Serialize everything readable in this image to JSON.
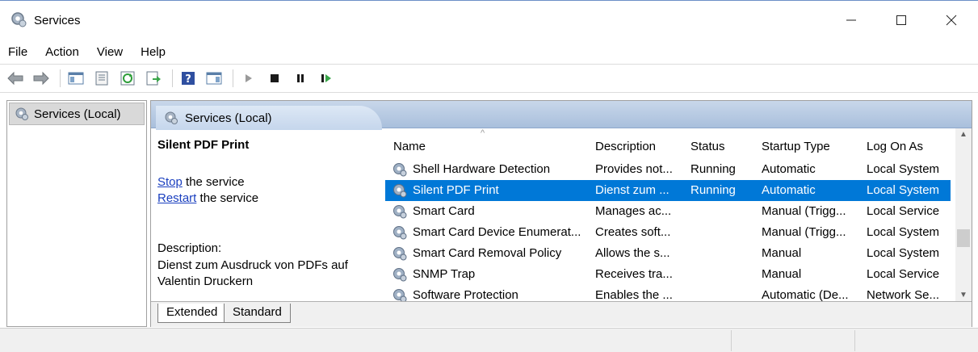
{
  "window": {
    "title": "Services"
  },
  "menu": [
    {
      "label": "File",
      "accel": "F"
    },
    {
      "label": "Action",
      "accel": "A"
    },
    {
      "label": "View",
      "accel": "V"
    },
    {
      "label": "Help",
      "accel": "H"
    }
  ],
  "toolbar": {
    "icons": [
      "back-arrow-icon",
      "forward-arrow-icon",
      "show-hide-console-tree-icon",
      "properties-icon",
      "refresh-icon",
      "export-list-icon",
      "help-icon",
      "show-hide-action-pane-icon",
      "start-service-icon",
      "stop-service-icon",
      "pause-service-icon",
      "resume-service-icon"
    ]
  },
  "tree": {
    "root": "Services (Local)"
  },
  "header": {
    "title": "Services (Local)"
  },
  "detail": {
    "service_name": "Silent PDF Print",
    "stop_link": "Stop",
    "stop_rest": " the service",
    "restart_link": "Restart",
    "restart_rest": " the service",
    "description_label": "Description:",
    "description_text": "Dienst zum Ausdruck von PDFs auf Valentin Druckern"
  },
  "columns": {
    "name": "Name",
    "description": "Description",
    "status": "Status",
    "startup": "Startup Type",
    "logon": "Log On As"
  },
  "rows": [
    {
      "name": "Shell Hardware Detection",
      "description": "Provides not...",
      "status": "Running",
      "startup": "Automatic",
      "logon": "Local System"
    },
    {
      "name": "Silent PDF Print",
      "description": "Dienst zum ...",
      "status": "Running",
      "startup": "Automatic",
      "logon": "Local System",
      "selected": true
    },
    {
      "name": "Smart Card",
      "description": "Manages ac...",
      "status": "",
      "startup": "Manual (Trigg...",
      "logon": "Local Service"
    },
    {
      "name": "Smart Card Device Enumerat...",
      "description": "Creates soft...",
      "status": "",
      "startup": "Manual (Trigg...",
      "logon": "Local System"
    },
    {
      "name": "Smart Card Removal Policy",
      "description": "Allows the s...",
      "status": "",
      "startup": "Manual",
      "logon": "Local System"
    },
    {
      "name": "SNMP Trap",
      "description": "Receives tra...",
      "status": "",
      "startup": "Manual",
      "logon": "Local Service"
    },
    {
      "name": "Software Protection",
      "description": "Enables the ...",
      "status": "",
      "startup": "Automatic (De...",
      "logon": "Network Se..."
    }
  ],
  "tabs": {
    "extended": "Extended",
    "standard": "Standard"
  },
  "colors": {
    "selection": "#0078d7",
    "header_band": "#a9bfdc",
    "link": "#1a3fbf"
  }
}
